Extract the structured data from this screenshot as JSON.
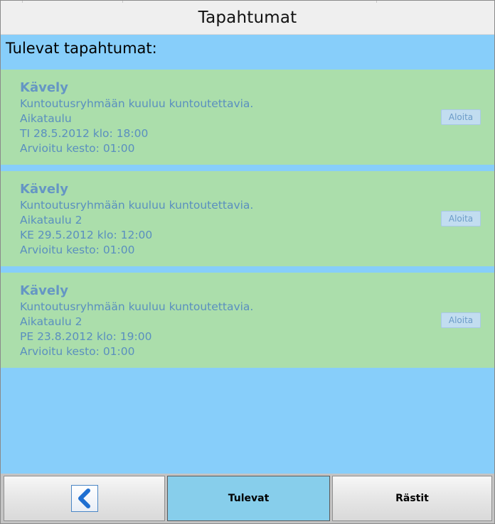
{
  "header": {
    "title": "Tapahtumat"
  },
  "section": {
    "heading": "Tulevat tapahtumat:"
  },
  "events": [
    {
      "name": "Kävely",
      "description": "Kuntoutusryhmään kuuluu kuntoutettavia.",
      "schedule": "Aikataulu",
      "datetime": "TI 28.5.2012 klo: 18:00",
      "duration": "Arvioitu kesto: 01:00",
      "start_label": "Aloita"
    },
    {
      "name": "Kävely",
      "description": "Kuntoutusryhmään kuuluu kuntoutettavia.",
      "schedule": "Aikataulu 2",
      "datetime": "KE 29.5.2012 klo: 12:00",
      "duration": "Arvioitu kesto: 01:00",
      "start_label": "Aloita"
    },
    {
      "name": "Kävely",
      "description": "Kuntoutusryhmään kuuluu kuntoutettavia.",
      "schedule": "Aikataulu 2",
      "datetime": "PE 23.8.2012 klo: 19:00",
      "duration": "Arvioitu kesto: 01:00",
      "start_label": "Aloita"
    }
  ],
  "bottom_nav": {
    "back_icon": "chevron-left-icon",
    "upcoming_label": "Tulevat",
    "overdue_label": "Rästit"
  },
  "colors": {
    "background": "#87cefa",
    "card": "#abdeab",
    "card_text": "#5a8fbf",
    "active_tab": "#87ceeb"
  }
}
